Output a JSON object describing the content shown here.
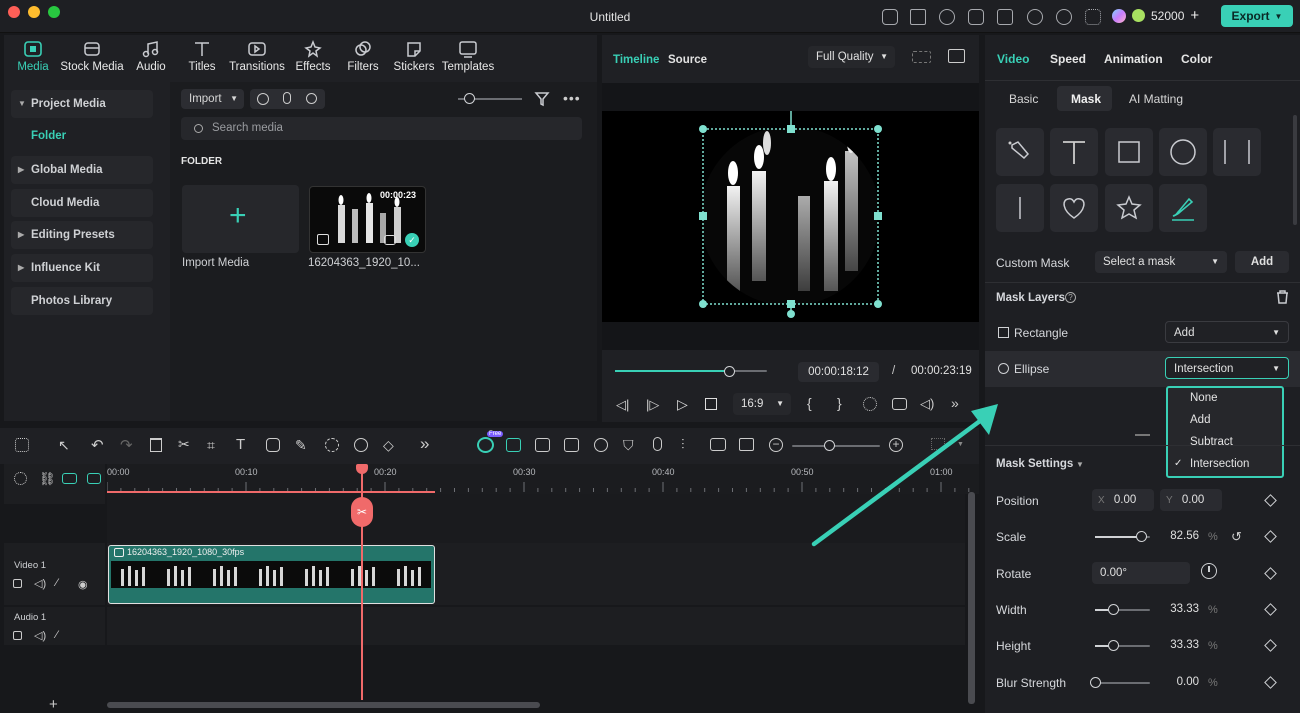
{
  "window": {
    "title": "Untitled"
  },
  "topbar": {
    "credits": "52000",
    "export_label": "Export"
  },
  "toolbar_tabs": [
    {
      "label": "Media",
      "icon": "media-icon"
    },
    {
      "label": "Stock Media",
      "icon": "stock-media-icon"
    },
    {
      "label": "Audio",
      "icon": "music-icon"
    },
    {
      "label": "Titles",
      "icon": "text-icon"
    },
    {
      "label": "Transitions",
      "icon": "transitions-icon"
    },
    {
      "label": "Effects",
      "icon": "effects-icon"
    },
    {
      "label": "Filters",
      "icon": "filters-icon"
    },
    {
      "label": "Stickers",
      "icon": "stickers-icon"
    },
    {
      "label": "Templates",
      "icon": "templates-icon"
    }
  ],
  "sidebar": {
    "items": [
      "Project Media",
      "Folder",
      "Global Media",
      "Cloud Media",
      "Editing Presets",
      "Influence Kit",
      "Photos Library"
    ]
  },
  "media": {
    "import_label": "Import",
    "search_placeholder": "Search media",
    "section_title": "FOLDER",
    "import_tile_label": "Import Media",
    "clip": {
      "duration": "00:00:23",
      "name": "16204363_1920_10..."
    }
  },
  "preview": {
    "tab_timeline": "Timeline",
    "tab_source": "Source",
    "quality": "Full Quality",
    "current_time": "00:00:18:12",
    "separator": "/",
    "total_time": "00:00:23:19",
    "aspect": "16:9",
    "progress": 0.75
  },
  "inspector": {
    "tabs": [
      "Video",
      "Speed",
      "Animation",
      "Color"
    ],
    "subtabs": [
      "Basic",
      "Mask",
      "AI Matting"
    ],
    "custom_mask_label": "Custom Mask",
    "select_mask": "Select a mask",
    "add_button": "Add",
    "mask_layers_label": "Mask Layers",
    "layers": [
      {
        "name": "Rectangle",
        "mode": "Add"
      },
      {
        "name": "Ellipse",
        "mode": "Intersection"
      }
    ],
    "dropdown_options": [
      "None",
      "Add",
      "Subtract",
      "Intersection"
    ],
    "dropdown_selected": "Intersection",
    "mask_settings_label": "Mask Settings",
    "position": {
      "label": "Position",
      "x_label": "X",
      "x": "0.00",
      "y_label": "Y",
      "y": "0.00"
    },
    "scale": {
      "label": "Scale",
      "value": "82.56",
      "unit": "%",
      "level": 0.83
    },
    "rotate": {
      "label": "Rotate",
      "value": "0.00°"
    },
    "width": {
      "label": "Width",
      "value": "33.33",
      "unit": "%",
      "level": 0.33
    },
    "height": {
      "label": "Height",
      "value": "33.33",
      "unit": "%",
      "level": 0.33
    },
    "blur": {
      "label": "Blur Strength",
      "value": "0.00",
      "unit": "%",
      "level": 0.0
    }
  },
  "timeline": {
    "ruler_labels": [
      "00:00",
      "00:10",
      "00:20",
      "00:30",
      "00:40",
      "00:50",
      "01:00"
    ],
    "free_badge": "Free",
    "tracks": [
      {
        "label": "Video 1"
      },
      {
        "label": "Audio 1"
      }
    ],
    "clip_name": "16204363_1920_1080_30fps"
  },
  "colors": {
    "accent": "#39d0b6",
    "playhead": "#f06a6a",
    "clip": "#24756a"
  }
}
